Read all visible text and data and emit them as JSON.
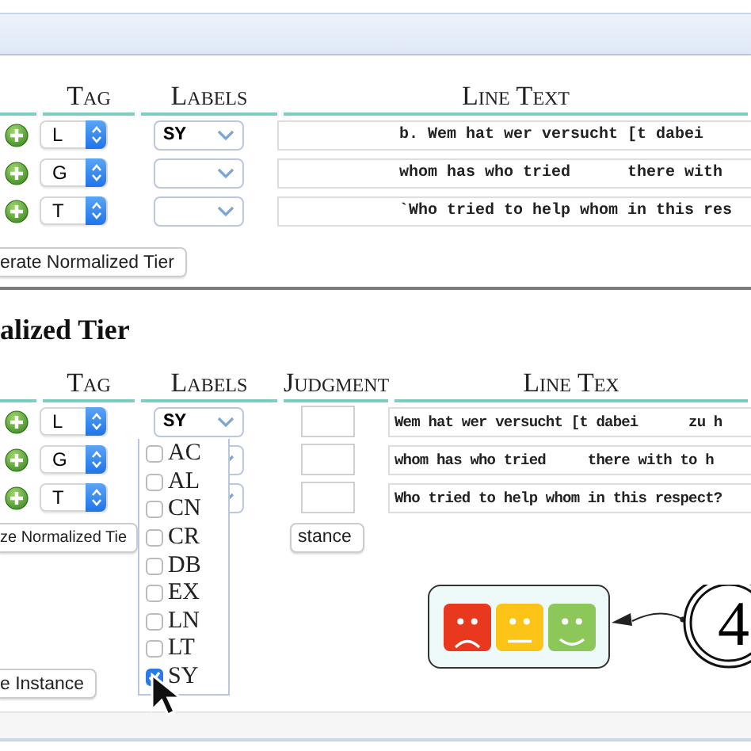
{
  "top_table": {
    "columns": [
      "Tag",
      "Labels",
      "Line Text"
    ],
    "rows": [
      {
        "tag": "L",
        "label": "SY",
        "line_text": "b. Wem hat wer versucht [t dabei"
      },
      {
        "tag": "G",
        "line_text": "whom has who tried      there with"
      },
      {
        "tag": "T",
        "line_text": "`Who tried to help whom in this res"
      }
    ]
  },
  "generate_button": "erate Normalized Tier",
  "normalized_tier": {
    "heading": "alized Tier",
    "columns": [
      "Tag",
      "Labels",
      "Judgment",
      "Line Tex"
    ],
    "rows": [
      {
        "tag": "L",
        "label": "SY",
        "line_text": "Wem hat wer versucht [t dabei      zu h"
      },
      {
        "tag": "G",
        "line_text": "whom has who tried     there with to h"
      },
      {
        "tag": "T",
        "line_text": "Who tried to help whom in this respect?"
      }
    ],
    "buttons": [
      "ze Normalized Tie",
      "stance",
      "e Instance"
    ],
    "label_menu": [
      {
        "label": "AC",
        "checked": false
      },
      {
        "label": "AL",
        "checked": false
      },
      {
        "label": "CN",
        "checked": false
      },
      {
        "label": "CR",
        "checked": false
      },
      {
        "label": "DB",
        "checked": false
      },
      {
        "label": "EX",
        "checked": false
      },
      {
        "label": "LN",
        "checked": false
      },
      {
        "label": "LT",
        "checked": false
      },
      {
        "label": "SY",
        "checked": true
      }
    ]
  },
  "annotation": {
    "faces": [
      {
        "kind": "sad",
        "color": "#e8391e"
      },
      {
        "kind": "neutral",
        "color": "#fbc416"
      },
      {
        "kind": "happy",
        "color": "#8cc75a"
      }
    ],
    "step": "4"
  }
}
